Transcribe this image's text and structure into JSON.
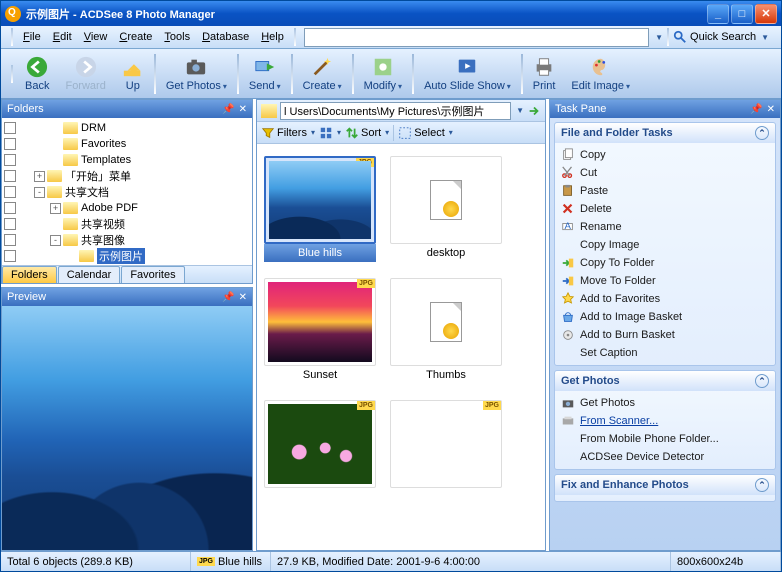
{
  "titlebar": {
    "title": "示例图片 - ACDSee 8 Photo Manager"
  },
  "menu": {
    "items": [
      "File",
      "Edit",
      "View",
      "Create",
      "Tools",
      "Database",
      "Help"
    ]
  },
  "quicksearch": {
    "label": "Quick Search",
    "value": ""
  },
  "address_small": "",
  "toolbar": {
    "back": "Back",
    "forward": "Forward",
    "up": "Up",
    "getphotos": "Get Photos",
    "send": "Send",
    "create": "Create",
    "modify": "Modify",
    "autoslide": "Auto Slide Show",
    "print": "Print",
    "editimage": "Edit Image"
  },
  "folders": {
    "title": "Folders",
    "tabs": [
      "Folders",
      "Calendar",
      "Favorites"
    ],
    "active_tab": 0,
    "tree": [
      {
        "indent": 2,
        "twist": "",
        "label": "DRM"
      },
      {
        "indent": 2,
        "twist": "",
        "label": "Favorites"
      },
      {
        "indent": 2,
        "twist": "",
        "label": "Templates"
      },
      {
        "indent": 1,
        "twist": "+",
        "label": "「开始」菜单"
      },
      {
        "indent": 1,
        "twist": "-",
        "label": "共享文档"
      },
      {
        "indent": 2,
        "twist": "+",
        "label": "Adobe PDF"
      },
      {
        "indent": 2,
        "twist": "",
        "label": "共享视频"
      },
      {
        "indent": 2,
        "twist": "-",
        "label": "共享图像"
      },
      {
        "indent": 3,
        "twist": "",
        "label": "示例图片",
        "selected": true
      }
    ]
  },
  "preview": {
    "title": "Preview"
  },
  "browser": {
    "path": "l Users\\Documents\\My Pictures\\示例图片",
    "filterbar": {
      "filters": "Filters",
      "sort": "Sort",
      "select": "Select"
    },
    "thumbs": [
      {
        "name": "Blue hills",
        "kind": "image-hills",
        "badge": "JPG",
        "selected": true
      },
      {
        "name": "desktop",
        "kind": "file",
        "badge": ""
      },
      {
        "name": "Sunset",
        "kind": "image-sunset",
        "badge": "JPG"
      },
      {
        "name": "Thumbs",
        "kind": "file",
        "badge": ""
      },
      {
        "name": "",
        "kind": "image-lotus",
        "badge": "JPG"
      },
      {
        "name": "",
        "kind": "image-winter",
        "badge": "JPG"
      }
    ]
  },
  "taskpane": {
    "title": "Task Pane",
    "groups": [
      {
        "name": "File and Folder Tasks",
        "items": [
          {
            "icon": "copy",
            "label": "Copy"
          },
          {
            "icon": "cut",
            "label": "Cut"
          },
          {
            "icon": "paste",
            "label": "Paste"
          },
          {
            "icon": "delete",
            "label": "Delete"
          },
          {
            "icon": "rename",
            "label": "Rename"
          },
          {
            "icon": "",
            "label": "Copy Image"
          },
          {
            "icon": "copyto",
            "label": "Copy To Folder"
          },
          {
            "icon": "moveto",
            "label": "Move To Folder"
          },
          {
            "icon": "star",
            "label": "Add to Favorites"
          },
          {
            "icon": "basket",
            "label": "Add to Image Basket"
          },
          {
            "icon": "burn",
            "label": "Add to Burn Basket"
          },
          {
            "icon": "",
            "label": "Set Caption"
          }
        ]
      },
      {
        "name": "Get Photos",
        "items": [
          {
            "icon": "camera",
            "label": "Get Photos"
          },
          {
            "icon": "scanner",
            "label": "From Scanner...",
            "link": true
          },
          {
            "icon": "",
            "label": "From Mobile Phone Folder..."
          },
          {
            "icon": "",
            "label": "ACDSee Device Detector"
          }
        ]
      },
      {
        "name": "Fix and Enhance Photos",
        "items": []
      }
    ]
  },
  "statusbar": {
    "total": "Total 6 objects  (289.8 KB)",
    "selected": "Blue hills",
    "detail": "27.9 KB, Modified Date: 2001-9-6 4:00:00",
    "dims": "800x600x24b"
  }
}
